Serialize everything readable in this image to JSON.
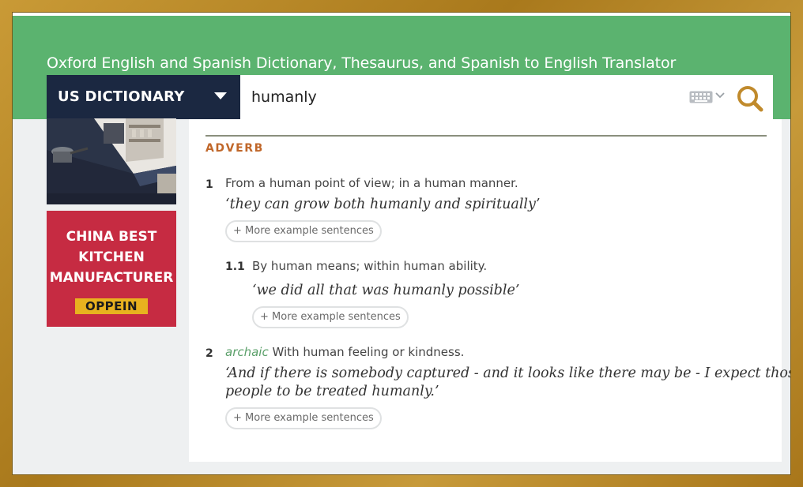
{
  "header": {
    "site_title": "Oxford English and Spanish Dictionary, Thesaurus, and Spanish to English Translator",
    "dictionary_selector": "US DICTIONARY"
  },
  "search": {
    "value": "humanly",
    "keyboard_icon": "keyboard-icon",
    "search_icon": "magnifier-icon"
  },
  "ads": {
    "kitchen_ad_lines": [
      "CHINA BEST",
      "KITCHEN",
      "MANUFACTURER"
    ],
    "kitchen_ad_brand": "OPPEIN"
  },
  "entry": {
    "part_of_speech": "ADVERB",
    "senses": [
      {
        "number": "1",
        "definition": "From a human point of view; in a human manner.",
        "example": "‘they can grow both humanly and spiritually’",
        "more_label": "+ More example sentences"
      },
      {
        "number": "1.1",
        "definition": "By human means; within human ability.",
        "example": "‘we did all that was humanly possible’",
        "more_label": "+ More example sentences"
      },
      {
        "number": "2",
        "register": "archaic",
        "definition": "With human feeling or kindness.",
        "example_line1": "‘And if there is somebody captured - and it looks like there may be - I expect those",
        "example_line2": "people to be treated humanly.’",
        "more_label": "+ More example sentences"
      }
    ]
  },
  "colors": {
    "header_green": "#5bb36f",
    "navy": "#1b2841",
    "part_of_speech": "#c0672a",
    "register": "#5ba06a",
    "ad_red": "#c62b42",
    "search_icon": "#c08a2c"
  }
}
